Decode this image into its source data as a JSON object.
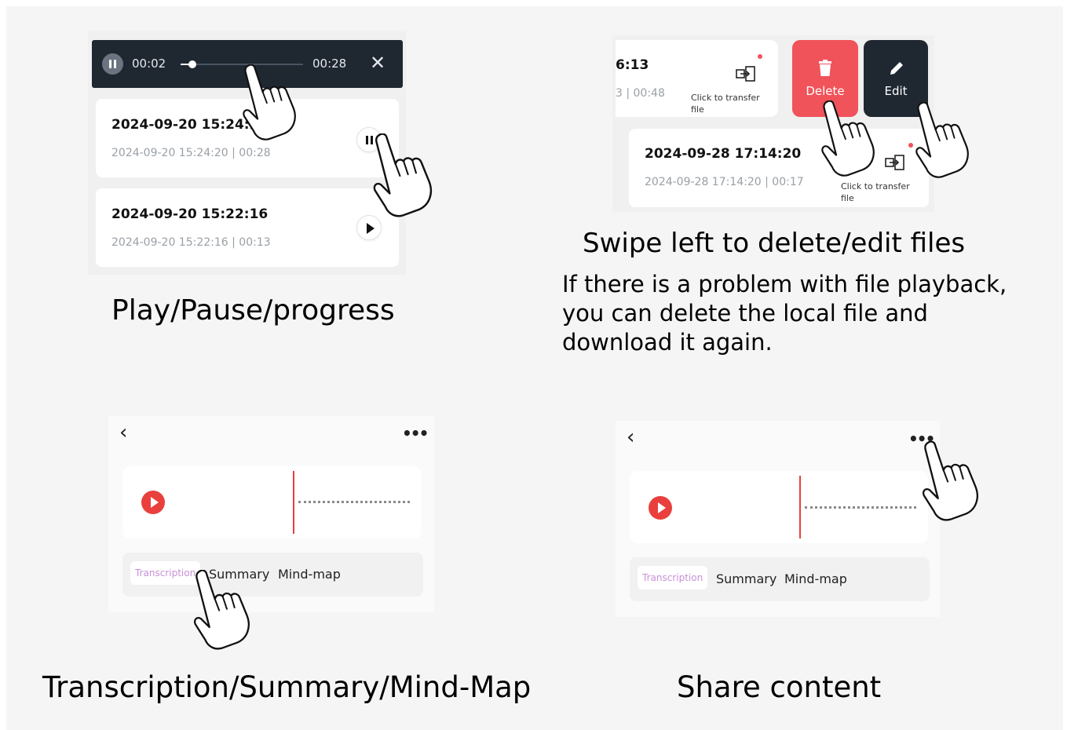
{
  "panel1": {
    "player": {
      "current_time": "00:02",
      "total_time": "00:28",
      "progress": 0.08,
      "close_glyph": "✕"
    },
    "recordings": [
      {
        "title": "2024-09-20 15:24:20",
        "subtitle": "2024-09-20 15:24:20  |  00:28",
        "state": "playing"
      },
      {
        "title": "2024-09-20 15:22:16",
        "subtitle": "2024-09-20 15:22:16  |  00:13",
        "state": "paused"
      }
    ],
    "caption": "Play/Pause/progress"
  },
  "panel2": {
    "partial_item": {
      "title": "6:13",
      "subtitle": "3  |  00:48",
      "transfer_note_line1": "Click to transfer",
      "transfer_note_line2": "file"
    },
    "delete_label": "Delete",
    "edit_label": "Edit",
    "item": {
      "title": "2024-09-28 17:14:20",
      "subtitle": "2024-09-28 17:14:20  |  00:17",
      "transfer_note_line1": "Click to transfer",
      "transfer_note_line2": "file"
    },
    "caption": "Swipe left to delete/edit files",
    "description_line1": "If there is a problem with file playback,",
    "description_line2": "you can delete the local file and",
    "description_line3": "download it again."
  },
  "panel3": {
    "back_glyph": "‹",
    "more_glyph": "•••",
    "tabs": [
      "Transcription",
      "Summary",
      "Mind-map"
    ],
    "caption": "Transcription/Summary/Mind-Map"
  },
  "panel4": {
    "back_glyph": "‹",
    "more_glyph": "•••",
    "tabs": [
      "Transcription",
      "Summary",
      "Mind-map"
    ],
    "caption": "Share content"
  },
  "colors": {
    "dark_bar": "#1f2731",
    "delete_red": "#f0535a",
    "record_red": "#e9403d",
    "tab_active_text": "#c790d6"
  },
  "icons": [
    "pause-icon",
    "close-icon",
    "play-icon",
    "trash-icon",
    "pencil-icon",
    "transfer-icon",
    "back-chevron-icon",
    "more-icon",
    "pointing-hand-icon"
  ]
}
